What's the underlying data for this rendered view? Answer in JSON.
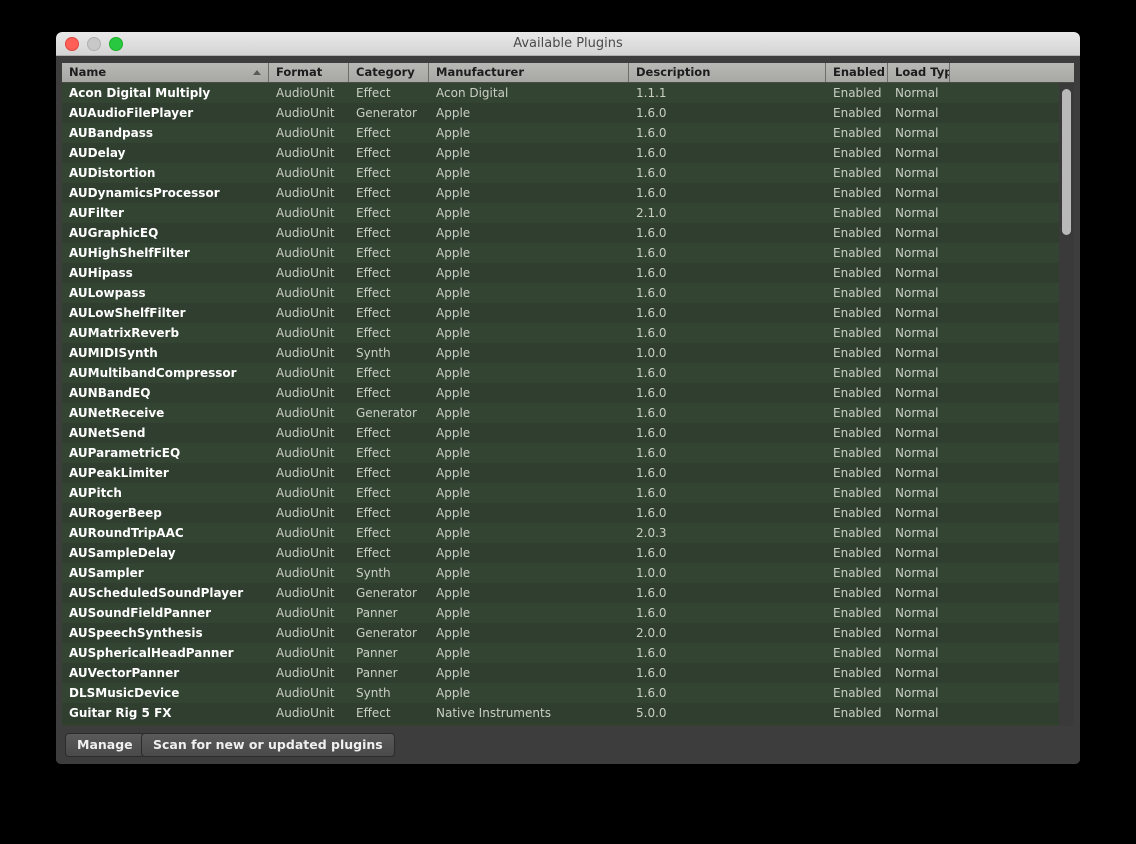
{
  "window": {
    "title": "Available Plugins",
    "traffic_lights": [
      "close",
      "minimize",
      "maximize"
    ]
  },
  "table": {
    "sort_column": "Name",
    "sort_direction": "ascending",
    "columns": [
      {
        "key": "name",
        "label": "Name"
      },
      {
        "key": "format",
        "label": "Format"
      },
      {
        "key": "category",
        "label": "Category"
      },
      {
        "key": "manufacturer",
        "label": "Manufacturer"
      },
      {
        "key": "description",
        "label": "Description"
      },
      {
        "key": "enabled",
        "label": "Enabled"
      },
      {
        "key": "loadtype",
        "label": "Load Type"
      },
      {
        "key": "spacer",
        "label": ""
      }
    ],
    "rows": [
      {
        "name": "Acon Digital Multiply",
        "format": "AudioUnit",
        "category": "Effect",
        "manufacturer": "Acon Digital",
        "description": "1.1.1",
        "enabled": "Enabled",
        "loadtype": "Normal"
      },
      {
        "name": "AUAudioFilePlayer",
        "format": "AudioUnit",
        "category": "Generator",
        "manufacturer": "Apple",
        "description": "1.6.0",
        "enabled": "Enabled",
        "loadtype": "Normal"
      },
      {
        "name": "AUBandpass",
        "format": "AudioUnit",
        "category": "Effect",
        "manufacturer": "Apple",
        "description": "1.6.0",
        "enabled": "Enabled",
        "loadtype": "Normal"
      },
      {
        "name": "AUDelay",
        "format": "AudioUnit",
        "category": "Effect",
        "manufacturer": "Apple",
        "description": "1.6.0",
        "enabled": "Enabled",
        "loadtype": "Normal"
      },
      {
        "name": "AUDistortion",
        "format": "AudioUnit",
        "category": "Effect",
        "manufacturer": "Apple",
        "description": "1.6.0",
        "enabled": "Enabled",
        "loadtype": "Normal"
      },
      {
        "name": "AUDynamicsProcessor",
        "format": "AudioUnit",
        "category": "Effect",
        "manufacturer": "Apple",
        "description": "1.6.0",
        "enabled": "Enabled",
        "loadtype": "Normal"
      },
      {
        "name": "AUFilter",
        "format": "AudioUnit",
        "category": "Effect",
        "manufacturer": "Apple",
        "description": "2.1.0",
        "enabled": "Enabled",
        "loadtype": "Normal"
      },
      {
        "name": "AUGraphicEQ",
        "format": "AudioUnit",
        "category": "Effect",
        "manufacturer": "Apple",
        "description": "1.6.0",
        "enabled": "Enabled",
        "loadtype": "Normal"
      },
      {
        "name": "AUHighShelfFilter",
        "format": "AudioUnit",
        "category": "Effect",
        "manufacturer": "Apple",
        "description": "1.6.0",
        "enabled": "Enabled",
        "loadtype": "Normal"
      },
      {
        "name": "AUHipass",
        "format": "AudioUnit",
        "category": "Effect",
        "manufacturer": "Apple",
        "description": "1.6.0",
        "enabled": "Enabled",
        "loadtype": "Normal"
      },
      {
        "name": "AULowpass",
        "format": "AudioUnit",
        "category": "Effect",
        "manufacturer": "Apple",
        "description": "1.6.0",
        "enabled": "Enabled",
        "loadtype": "Normal"
      },
      {
        "name": "AULowShelfFilter",
        "format": "AudioUnit",
        "category": "Effect",
        "manufacturer": "Apple",
        "description": "1.6.0",
        "enabled": "Enabled",
        "loadtype": "Normal"
      },
      {
        "name": "AUMatrixReverb",
        "format": "AudioUnit",
        "category": "Effect",
        "manufacturer": "Apple",
        "description": "1.6.0",
        "enabled": "Enabled",
        "loadtype": "Normal"
      },
      {
        "name": "AUMIDISynth",
        "format": "AudioUnit",
        "category": "Synth",
        "manufacturer": "Apple",
        "description": "1.0.0",
        "enabled": "Enabled",
        "loadtype": "Normal"
      },
      {
        "name": "AUMultibandCompressor",
        "format": "AudioUnit",
        "category": "Effect",
        "manufacturer": "Apple",
        "description": "1.6.0",
        "enabled": "Enabled",
        "loadtype": "Normal"
      },
      {
        "name": "AUNBandEQ",
        "format": "AudioUnit",
        "category": "Effect",
        "manufacturer": "Apple",
        "description": "1.6.0",
        "enabled": "Enabled",
        "loadtype": "Normal"
      },
      {
        "name": "AUNetReceive",
        "format": "AudioUnit",
        "category": "Generator",
        "manufacturer": "Apple",
        "description": "1.6.0",
        "enabled": "Enabled",
        "loadtype": "Normal"
      },
      {
        "name": "AUNetSend",
        "format": "AudioUnit",
        "category": "Effect",
        "manufacturer": "Apple",
        "description": "1.6.0",
        "enabled": "Enabled",
        "loadtype": "Normal"
      },
      {
        "name": "AUParametricEQ",
        "format": "AudioUnit",
        "category": "Effect",
        "manufacturer": "Apple",
        "description": "1.6.0",
        "enabled": "Enabled",
        "loadtype": "Normal"
      },
      {
        "name": "AUPeakLimiter",
        "format": "AudioUnit",
        "category": "Effect",
        "manufacturer": "Apple",
        "description": "1.6.0",
        "enabled": "Enabled",
        "loadtype": "Normal"
      },
      {
        "name": "AUPitch",
        "format": "AudioUnit",
        "category": "Effect",
        "manufacturer": "Apple",
        "description": "1.6.0",
        "enabled": "Enabled",
        "loadtype": "Normal"
      },
      {
        "name": "AURogerBeep",
        "format": "AudioUnit",
        "category": "Effect",
        "manufacturer": "Apple",
        "description": "1.6.0",
        "enabled": "Enabled",
        "loadtype": "Normal"
      },
      {
        "name": "AURoundTripAAC",
        "format": "AudioUnit",
        "category": "Effect",
        "manufacturer": "Apple",
        "description": "2.0.3",
        "enabled": "Enabled",
        "loadtype": "Normal"
      },
      {
        "name": "AUSampleDelay",
        "format": "AudioUnit",
        "category": "Effect",
        "manufacturer": "Apple",
        "description": "1.6.0",
        "enabled": "Enabled",
        "loadtype": "Normal"
      },
      {
        "name": "AUSampler",
        "format": "AudioUnit",
        "category": "Synth",
        "manufacturer": "Apple",
        "description": "1.0.0",
        "enabled": "Enabled",
        "loadtype": "Normal"
      },
      {
        "name": "AUScheduledSoundPlayer",
        "format": "AudioUnit",
        "category": "Generator",
        "manufacturer": "Apple",
        "description": "1.6.0",
        "enabled": "Enabled",
        "loadtype": "Normal"
      },
      {
        "name": "AUSoundFieldPanner",
        "format": "AudioUnit",
        "category": "Panner",
        "manufacturer": "Apple",
        "description": "1.6.0",
        "enabled": "Enabled",
        "loadtype": "Normal"
      },
      {
        "name": "AUSpeechSynthesis",
        "format": "AudioUnit",
        "category": "Generator",
        "manufacturer": "Apple",
        "description": "2.0.0",
        "enabled": "Enabled",
        "loadtype": "Normal"
      },
      {
        "name": "AUSphericalHeadPanner",
        "format": "AudioUnit",
        "category": "Panner",
        "manufacturer": "Apple",
        "description": "1.6.0",
        "enabled": "Enabled",
        "loadtype": "Normal"
      },
      {
        "name": "AUVectorPanner",
        "format": "AudioUnit",
        "category": "Panner",
        "manufacturer": "Apple",
        "description": "1.6.0",
        "enabled": "Enabled",
        "loadtype": "Normal"
      },
      {
        "name": "DLSMusicDevice",
        "format": "AudioUnit",
        "category": "Synth",
        "manufacturer": "Apple",
        "description": "1.6.0",
        "enabled": "Enabled",
        "loadtype": "Normal"
      },
      {
        "name": "Guitar Rig 5 FX",
        "format": "AudioUnit",
        "category": "Effect",
        "manufacturer": "Native Instruments",
        "description": "5.0.0",
        "enabled": "Enabled",
        "loadtype": "Normal"
      }
    ]
  },
  "footer": {
    "manage_label": "Manage",
    "scan_label": "Scan for new or updated plugins"
  },
  "colors": {
    "window_chrome": "#3d3d3d",
    "titlebar": "#d9d9d9",
    "header_bg": "#aeaeaa",
    "row_bg": "#344433",
    "row_bg_alt": "#2f3e2e",
    "name_text": "#ffffff",
    "cell_text": "#c9cfc4",
    "close": "#ff5f57",
    "minimize": "#c8c8c8",
    "maximize": "#28c940",
    "scrollbar_thumb": "#b9b9b9"
  }
}
